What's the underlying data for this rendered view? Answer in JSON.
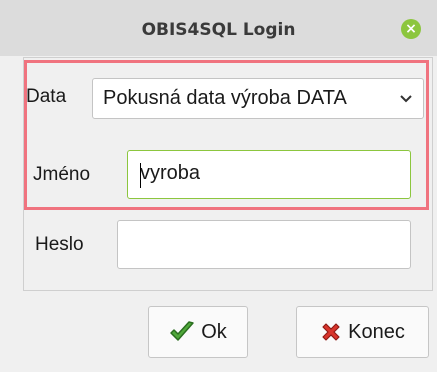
{
  "window": {
    "title": "OBIS4SQL Login",
    "close_glyph": "×"
  },
  "form": {
    "data_label": "Data",
    "data_value": "Pokusná data výroba DATA",
    "name_label": "Jméno",
    "name_value": "vyroba",
    "password_label": "Heslo",
    "password_value": ""
  },
  "buttons": {
    "ok_label": "Ok",
    "konec_label": "Konec"
  },
  "icons": {
    "close": "close-icon",
    "dropdown": "chevron-down-icon",
    "ok": "checkmark-icon",
    "konec": "red-x-icon"
  },
  "colors": {
    "accent_green": "#8cc63e",
    "highlight_red": "#f0737f",
    "cancel_red": "#d9342b"
  }
}
